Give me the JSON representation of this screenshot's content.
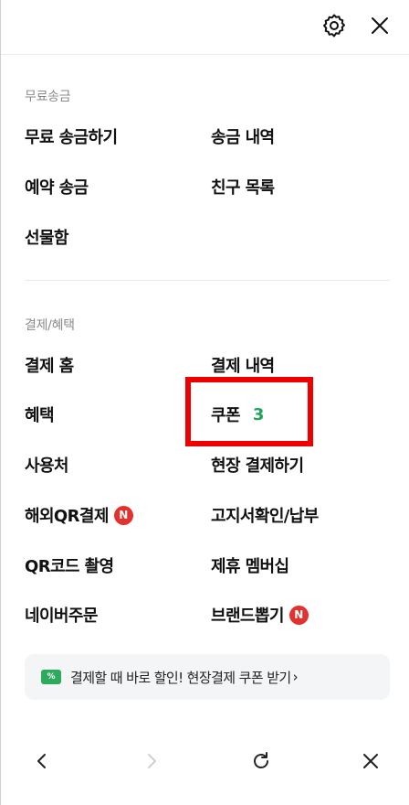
{
  "header": {
    "icons": [
      "gear-icon",
      "close-icon"
    ]
  },
  "transfer": {
    "section_label": "무료송금",
    "items": [
      "무료 송금하기",
      "송금 내역",
      "예약 송금",
      "친구 목록",
      "선물함"
    ]
  },
  "payment": {
    "section_label": "결제/혜택",
    "home": "결제 홈",
    "history": "결제 내역",
    "benefits": "혜택",
    "coupon": "쿠폰",
    "coupon_count": "3",
    "places": "사용처",
    "onsite_pay": "현장 결제하기",
    "overseas_qr": "해외QR결제",
    "bill_check": "고지서확인/납부",
    "qr_scan": "QR코드 촬영",
    "partner_membership": "제휴 멤버십",
    "naver_order": "네이버주문",
    "brand_draw": "브랜드뽑기",
    "new_badge": "N"
  },
  "banner": {
    "icon_text": "%",
    "text": "결제할 때 바로 할인! 현장결제 쿠폰 받기",
    "chevron": "›"
  },
  "bottom_nav": {
    "icons": [
      "back-icon",
      "forward-icon",
      "refresh-icon",
      "close-icon"
    ]
  },
  "colors": {
    "accent_green": "#1fa45a",
    "badge_red": "#e3312d",
    "highlight_red": "#ee0000"
  }
}
